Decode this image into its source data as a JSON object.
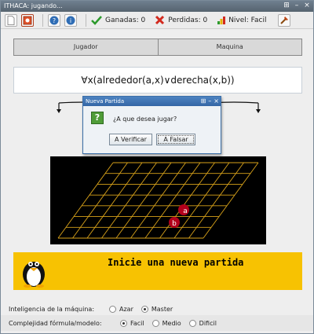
{
  "window": {
    "title": "ITHACA: jugando..."
  },
  "title_controls": [
    "⊞",
    "–",
    "×"
  ],
  "stats": {
    "won_label": "Ganadas: 0",
    "lost_label": "Perdidas: 0",
    "level_label": "Nivel: Facil"
  },
  "players": [
    "Jugador",
    "Maquina"
  ],
  "formula": "∀x(alrededor(a,x)∨derecha(x,b))",
  "board": {
    "pieces": [
      "a",
      "b"
    ]
  },
  "message": "Inicie una nueva partida",
  "options": {
    "ai_label": "Inteligencia de la máquina:",
    "ai_choices": [
      {
        "label": "Azar",
        "selected": false
      },
      {
        "label": "Master",
        "selected": true
      }
    ],
    "complexity_label": "Complejidad fórmula/modelo:",
    "complexity_choices": [
      {
        "label": "Facil",
        "selected": true
      },
      {
        "label": "Medio",
        "selected": false
      },
      {
        "label": "Dificil",
        "selected": false
      }
    ]
  },
  "dialog": {
    "title": "Nueva Partida",
    "question": "¿A que desea jugar?",
    "verify_label": "A Verificar",
    "falsify_label": "A Falsar",
    "icon": "?"
  },
  "colors": {
    "message_bg": "#f7c202",
    "board_bg": "#000000",
    "grid": "#d8a21a",
    "piece": "#b3001b"
  }
}
